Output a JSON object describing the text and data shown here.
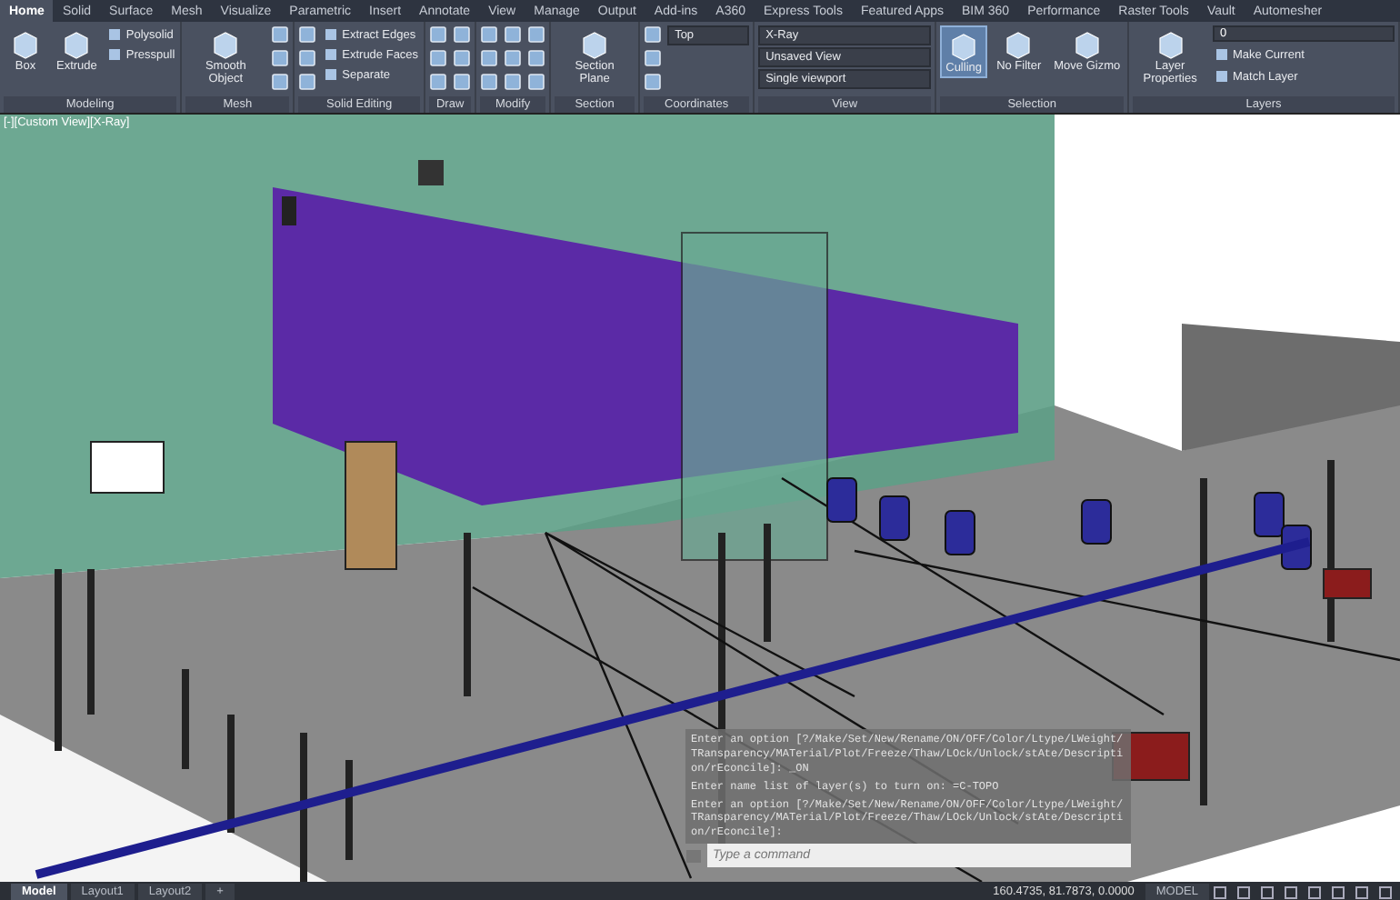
{
  "ribbon": {
    "tabs": [
      {
        "label": "Home",
        "selected": true
      },
      {
        "label": "Solid",
        "selected": false
      },
      {
        "label": "Surface",
        "selected": false
      },
      {
        "label": "Mesh",
        "selected": false
      },
      {
        "label": "Visualize",
        "selected": false
      },
      {
        "label": "Parametric",
        "selected": false
      },
      {
        "label": "Insert",
        "selected": false
      },
      {
        "label": "Annotate",
        "selected": false
      },
      {
        "label": "View",
        "selected": false
      },
      {
        "label": "Manage",
        "selected": false
      },
      {
        "label": "Output",
        "selected": false
      },
      {
        "label": "Add-ins",
        "selected": false
      },
      {
        "label": "A360",
        "selected": false
      },
      {
        "label": "Express Tools",
        "selected": false
      },
      {
        "label": "Featured Apps",
        "selected": false
      },
      {
        "label": "BIM 360",
        "selected": false
      },
      {
        "label": "Performance",
        "selected": false
      },
      {
        "label": "Raster Tools",
        "selected": false
      },
      {
        "label": "Vault",
        "selected": false
      },
      {
        "label": "Automesher",
        "selected": false
      }
    ],
    "panels": [
      {
        "title": "Modeling",
        "items": [
          {
            "kind": "large",
            "label": "Box",
            "selected": false
          },
          {
            "kind": "large",
            "label": "Extrude",
            "selected": false
          },
          {
            "kind": "stack",
            "labels": [
              "Polysolid",
              "Presspull"
            ]
          }
        ]
      },
      {
        "title": "Mesh",
        "items": [
          {
            "kind": "large",
            "label": "Smooth Object",
            "selected": false
          },
          {
            "kind": "icons"
          }
        ]
      },
      {
        "title": "Solid Editing",
        "items": [
          {
            "kind": "icons"
          },
          {
            "kind": "stack",
            "labels": [
              "Extract Edges",
              "Extrude Faces",
              "Separate"
            ]
          }
        ]
      },
      {
        "title": "Draw",
        "items": [
          {
            "kind": "icons"
          },
          {
            "kind": "icons"
          }
        ]
      },
      {
        "title": "Modify",
        "items": [
          {
            "kind": "icons"
          },
          {
            "kind": "icons"
          },
          {
            "kind": "icons"
          }
        ]
      },
      {
        "title": "Section",
        "items": [
          {
            "kind": "large",
            "label": "Section Plane",
            "selected": false
          }
        ]
      },
      {
        "title": "Coordinates",
        "items": [
          {
            "kind": "icons"
          },
          {
            "kind": "dropdowns",
            "labels": [
              "Top"
            ]
          }
        ]
      },
      {
        "title": "View",
        "items": [
          {
            "kind": "dropdowns",
            "labels": [
              "X-Ray",
              "Unsaved View",
              "Single viewport"
            ]
          }
        ]
      },
      {
        "title": "Selection",
        "items": [
          {
            "kind": "large",
            "label": "Culling",
            "selected": true
          },
          {
            "kind": "large",
            "label": "No Filter",
            "selected": false
          },
          {
            "kind": "large",
            "label": "Move Gizmo",
            "selected": false
          }
        ]
      },
      {
        "title": "Layers",
        "items": [
          {
            "kind": "large",
            "label": "Layer Properties",
            "selected": false
          },
          {
            "kind": "layers",
            "current": "0",
            "labels": [
              "Make Current",
              "Match Layer"
            ]
          }
        ]
      }
    ]
  },
  "viewport": {
    "label": "[-][Custom View][X-Ray]"
  },
  "command_line": {
    "history": [
      "Enter an option [?/Make/Set/New/Rename/ON/OFF/Color/Ltype/LWeight/TRansparency/MATerial/Plot/Freeze/Thaw/LOck/Unlock/stAte/Description/rEconcile]: _ON",
      "Enter name list of layer(s) to turn on: =C-TOPO",
      "Enter an option [?/Make/Set/New/Rename/ON/OFF/Color/Ltype/LWeight/TRansparency/MATerial/Plot/Freeze/Thaw/LOck/Unlock/stAte/Description/rEconcile]:"
    ],
    "placeholder": "Type a command"
  },
  "status_bar": {
    "layouts": [
      {
        "label": "Model",
        "selected": true
      },
      {
        "label": "Layout1",
        "selected": false
      },
      {
        "label": "Layout2",
        "selected": false
      }
    ],
    "add_tab": "+",
    "coordinates": "160.4735, 81.7873, 0.0000",
    "space": "MODEL"
  }
}
